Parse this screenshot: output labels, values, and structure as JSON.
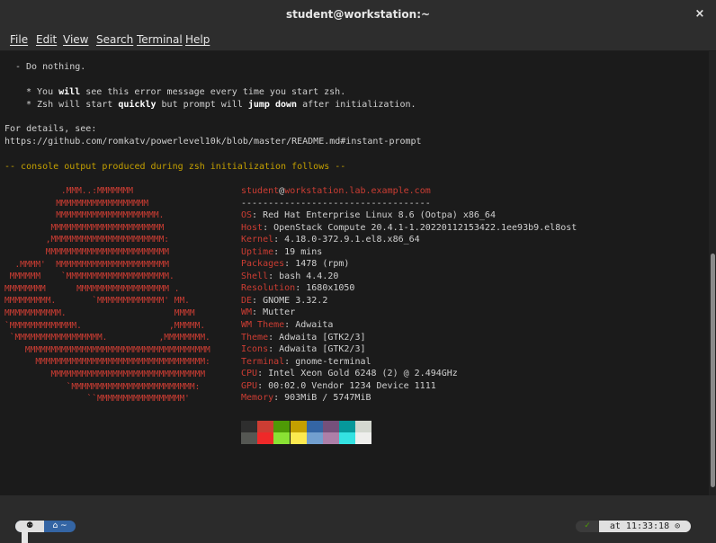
{
  "window": {
    "title": "student@workstation:~",
    "close_glyph": "×"
  },
  "menu": {
    "items": [
      "File",
      "Edit",
      "View",
      "Search",
      "Terminal",
      "Help"
    ]
  },
  "terminal": {
    "lines": {
      "do_nothing": "- Do nothing.",
      "bullet1_a": "* You ",
      "bullet1_b": "will",
      "bullet1_c": " see this error message every time you start zsh.",
      "bullet2_a": "* Zsh will start ",
      "bullet2_b": "quickly",
      "bullet2_c": " but prompt will ",
      "bullet2_d": "jump down",
      "bullet2_e": " after initialization.",
      "details": "For details, see:",
      "url": "https://github.com/romkatv/powerlevel10k/blob/master/README.md#instant-prompt",
      "console_notice": "-- console output produced during zsh initialization follows --"
    },
    "ascii_logo": [
      "           .MMM..:MMMMMMM",
      "          MMMMMMMMMMMMMMMMMM",
      "          MMMMMMMMMMMMMMMMMMMM.",
      "         MMMMMMMMMMMMMMMMMMMMMM",
      "        ,MMMMMMMMMMMMMMMMMMMMMM:",
      "        MMMMMMMMMMMMMMMMMMMMMMMM",
      "  .MMMM'  MMMMMMMMMMMMMMMMMMMMMM",
      " MMMMMM    `MMMMMMMMMMMMMMMMMMMM.",
      "MMMMMMMM      MMMMMMMMMMMMMMMMMM .",
      "MMMMMMMMM.       `MMMMMMMMMMMMM' MM.",
      "MMMMMMMMMMM.                     MMMM",
      "`MMMMMMMMMMMMM.                 ,MMMMM.",
      " `MMMMMMMMMMMMMMMMM.          ,MMMMMMMM.",
      "    MMMMMMMMMMMMMMMMMMMMMMMMMMMMMMMMMMMM",
      "      MMMMMMMMMMMMMMMMMMMMMMMMMMMMMMMMM:",
      "         MMMMMMMMMMMMMMMMMMMMMMMMMMMMMM",
      "            `MMMMMMMMMMMMMMMMMMMMMMMM:",
      "                ``MMMMMMMMMMMMMMMMM'"
    ],
    "sysinfo": {
      "user": "student",
      "at": "@",
      "host": "workstation.lab.example.com",
      "separator": "-----------------------------------",
      "rows": [
        {
          "key": "OS",
          "value": "Red Hat Enterprise Linux 8.6 (Ootpa) x86_64"
        },
        {
          "key": "Host",
          "value": "OpenStack Compute 20.4.1-1.20220112153422.1ee93b9.el8ost"
        },
        {
          "key": "Kernel",
          "value": "4.18.0-372.9.1.el8.x86_64"
        },
        {
          "key": "Uptime",
          "value": "19 mins"
        },
        {
          "key": "Packages",
          "value": "1478 (rpm)"
        },
        {
          "key": "Shell",
          "value": "bash 4.4.20"
        },
        {
          "key": "Resolution",
          "value": "1680x1050"
        },
        {
          "key": "DE",
          "value": "GNOME 3.32.2"
        },
        {
          "key": "WM",
          "value": "Mutter"
        },
        {
          "key": "WM Theme",
          "value": "Adwaita"
        },
        {
          "key": "Theme",
          "value": "Adwaita [GTK2/3]"
        },
        {
          "key": "Icons",
          "value": "Adwaita [GTK2/3]"
        },
        {
          "key": "Terminal",
          "value": "gnome-terminal"
        },
        {
          "key": "CPU",
          "value": "Intel Xeon Gold 6248 (2) @ 2.494GHz"
        },
        {
          "key": "GPU",
          "value": "00:02.0 Vendor 1234 Device 1111"
        },
        {
          "key": "Memory",
          "value": "903MiB / 5747MiB"
        }
      ],
      "palette_top": [
        "#2e2e2e",
        "#cc3d33",
        "#4e9a06",
        "#c4a000",
        "#3465a4",
        "#75507b",
        "#06989a",
        "#d3d7cf"
      ],
      "palette_bottom": [
        "#555753",
        "#ef2929",
        "#8ae234",
        "#fce94f",
        "#729fcf",
        "#ad7fa8",
        "#34e2e2",
        "#eeeeec"
      ]
    }
  },
  "prompt": {
    "left_icon": "redhat-icon",
    "left_glyph": "⚉",
    "home_glyph": "⌂ ~",
    "status_glyph": "✓",
    "time_text": "at 11:33:18 ⊙"
  }
}
